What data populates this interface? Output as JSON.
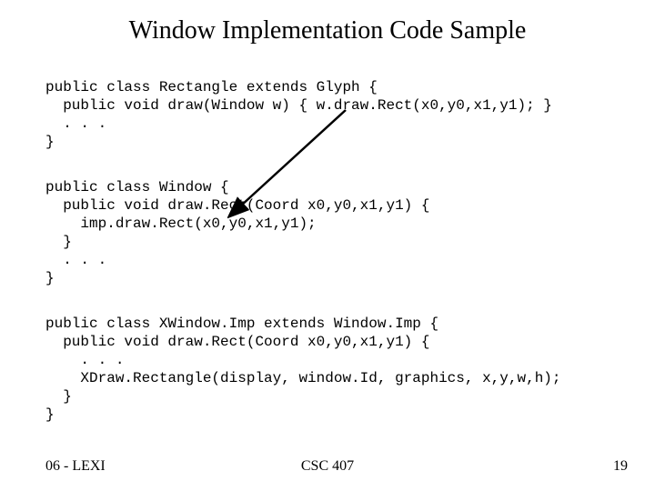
{
  "title": "Window Implementation Code Sample",
  "code": {
    "block1": "public class Rectangle extends Glyph {\n  public void draw(Window w) { w.draw.Rect(x0,y0,x1,y1); }\n  . . .\n}",
    "block2": "public class Window {\n  public void draw.Rect(Coord x0,y0,x1,y1) {\n    imp.draw.Rect(x0,y0,x1,y1);\n  }\n  . . .\n}",
    "block3": "public class XWindow.Imp extends Window.Imp {\n  public void draw.Rect(Coord x0,y0,x1,y1) {\n    . . .\n    XDraw.Rectangle(display, window.Id, graphics, x,y,w,h);\n  }\n}"
  },
  "footer": {
    "left": "06 - LEXI",
    "center": "CSC 407",
    "right": "19"
  }
}
